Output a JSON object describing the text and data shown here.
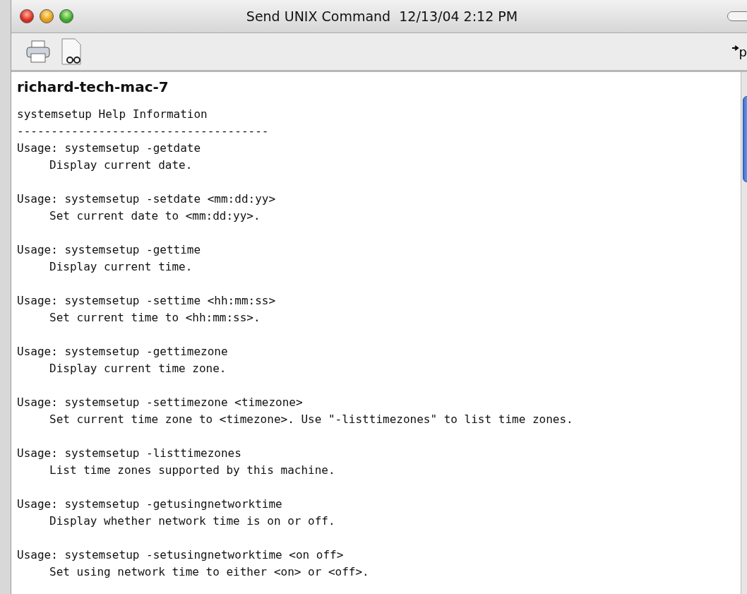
{
  "window": {
    "title": "Send UNIX Command  12/13/04 2:12 PM"
  },
  "toolbar": {
    "right_text": "p"
  },
  "output": {
    "host": "richard-tech-mac-7",
    "heading": "systemsetup Help Information",
    "separator": "-------------------------------------",
    "entries": [
      {
        "usage": "Usage: systemsetup -getdate",
        "description": "Display current date."
      },
      {
        "usage": "Usage: systemsetup -setdate <mm:dd:yy>",
        "description": "Set current date to <mm:dd:yy>."
      },
      {
        "usage": "Usage: systemsetup -gettime",
        "description": "Display current time."
      },
      {
        "usage": "Usage: systemsetup -settime <hh:mm:ss>",
        "description": "Set current time to <hh:mm:ss>."
      },
      {
        "usage": "Usage: systemsetup -gettimezone",
        "description": "Display current time zone."
      },
      {
        "usage": "Usage: systemsetup -settimezone <timezone>",
        "description": "Set current time zone to <timezone>. Use \"-listtimezones\" to list time zones."
      },
      {
        "usage": "Usage: systemsetup -listtimezones",
        "description": "List time zones supported by this machine."
      },
      {
        "usage": "Usage: systemsetup -getusingnetworktime",
        "description": "Display whether network time is on or off."
      },
      {
        "usage": "Usage: systemsetup -setusingnetworktime <on off>",
        "description": "Set using network time to either <on> or <off>."
      }
    ]
  }
}
